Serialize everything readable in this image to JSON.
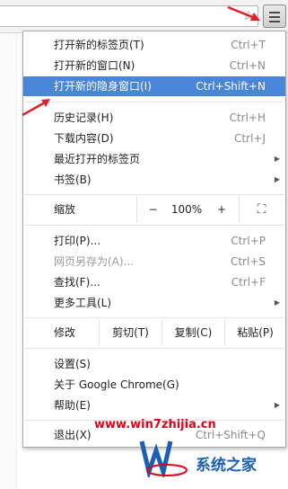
{
  "toolbar": {
    "star_icon": "bookmark-star-icon",
    "menu_icon": "hamburger-menu-icon"
  },
  "menu": {
    "group1": [
      {
        "label": "打开新的标签页(T)",
        "shortcut": "Ctrl+T"
      },
      {
        "label": "打开新的窗口(N)",
        "shortcut": "Ctrl+N"
      },
      {
        "label": "打开新的隐身窗口(I)",
        "shortcut": "Ctrl+Shift+N"
      }
    ],
    "group2": [
      {
        "label": "历史记录(H)",
        "shortcut": "Ctrl+H"
      },
      {
        "label": "下载内容(D)",
        "shortcut": "Ctrl+J"
      },
      {
        "label": "最近打开的标签页",
        "shortcut": ""
      },
      {
        "label": "书签(B)",
        "shortcut": ""
      }
    ],
    "zoom": {
      "label": "缩放",
      "minus": "−",
      "value": "100%",
      "plus": "+"
    },
    "group3": [
      {
        "label": "打印(P)...",
        "shortcut": "Ctrl+P"
      },
      {
        "label": "网页另存为(A)...",
        "shortcut": "Ctrl+S"
      },
      {
        "label": "查找(F)...",
        "shortcut": "Ctrl+F"
      },
      {
        "label": "更多工具(L)",
        "shortcut": ""
      }
    ],
    "edit": {
      "label": "修改",
      "cut": "剪切(T)",
      "copy": "复制(C)",
      "paste": "粘贴(P)"
    },
    "group4": [
      {
        "label": "设置(S)",
        "shortcut": ""
      },
      {
        "label": "关于 Google Chrome(G)",
        "shortcut": ""
      },
      {
        "label": "帮助(E)",
        "shortcut": ""
      }
    ],
    "exit": {
      "label": "退出(X)",
      "shortcut": "Ctrl+Shift+Q"
    }
  },
  "watermark": {
    "url": "www.win7zhijia.cn",
    "site_name": "系统之家"
  },
  "colors": {
    "highlight": "#4a86d8",
    "arrow": "#e0202a",
    "watermark_red": "#e0001a",
    "watermark_blue": "#1a5fb4"
  }
}
